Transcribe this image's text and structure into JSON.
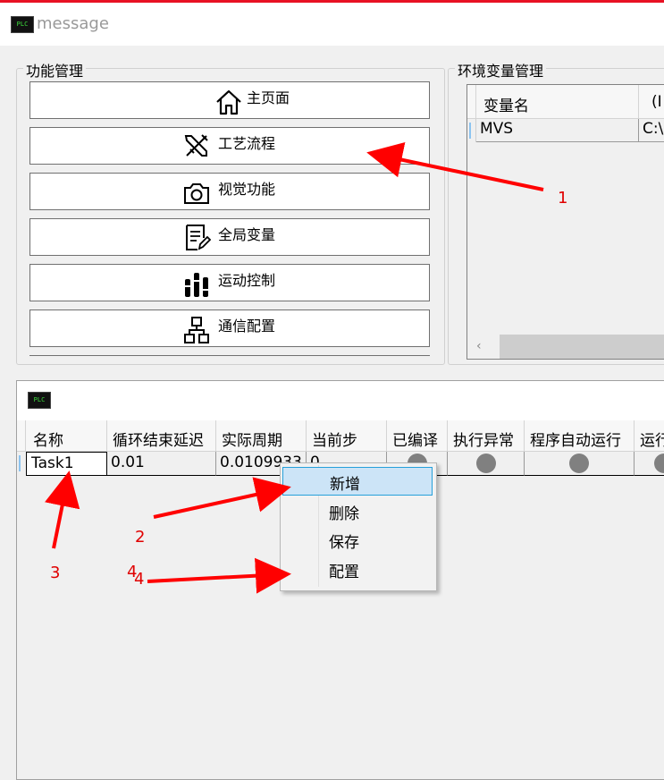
{
  "window": {
    "title": "message",
    "logo_text": "PLC"
  },
  "function_panel": {
    "title": "功能管理",
    "buttons": [
      {
        "label": "主页面",
        "icon": "home-icon"
      },
      {
        "label": "工艺流程",
        "icon": "tools-icon"
      },
      {
        "label": "视觉功能",
        "icon": "camera-icon"
      },
      {
        "label": "全局变量",
        "icon": "edit-document-icon"
      },
      {
        "label": "运动控制",
        "icon": "equalizer-icon"
      },
      {
        "label": "通信配置",
        "icon": "network-icon"
      }
    ]
  },
  "env_panel": {
    "title": "环境变量管理",
    "columns": [
      "变量名",
      "(I"
    ],
    "rows": [
      [
        "MVS",
        "C:\\"
      ]
    ]
  },
  "task_panel": {
    "logo_text": "PLC",
    "columns": [
      "名称",
      "循环结束延迟",
      "实际周期",
      "当前步",
      "已编译",
      "执行异常",
      "程序自动运行",
      "运行"
    ],
    "rows": [
      {
        "name": "Task1",
        "delay": "0.01",
        "period": "0.0109933",
        "step": "0"
      }
    ]
  },
  "context_menu": {
    "items": [
      "新增",
      "删除",
      "保存",
      "配置"
    ],
    "selected": 0
  },
  "annotations": {
    "a1": "1",
    "a2": "2",
    "a3": "3",
    "a4": "4",
    "a4b": "4"
  },
  "colors": {
    "arrow": "#ff0000",
    "status_dot": "#808080",
    "menu_highlight": "#cce4f7"
  }
}
